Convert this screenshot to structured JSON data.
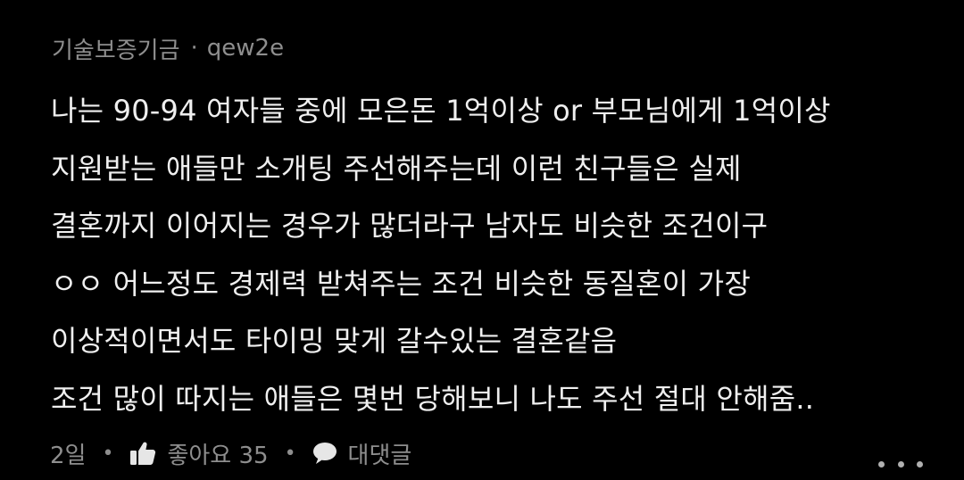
{
  "comment": {
    "author_group": "기술보증기금",
    "separator": "·",
    "username": "qew2e",
    "lines": [
      "나는 90-94 여자들 중에 모은돈 1억이상 or 부모님에게 1억이상",
      "지원받는 애들만 소개팅 주선해주는데 이런 친구들은 실제",
      "결혼까지 이어지는 경우가 많더라구 남자도 비슷한 조건이구",
      "ㅇㅇ 어느정도 경제력 받쳐주는 조건 비슷한 동질혼이 가장",
      "이상적이면서도 타이밍 맞게 갈수있는 결혼같음",
      "조건 많이 따지는 애들은 몇번 당해보니 나도 주선 절대 안해줌.."
    ],
    "footer": {
      "time": "2일",
      "dot": "•",
      "like_label": "좋아요 35",
      "reply_label": "대댓글"
    }
  },
  "colors": {
    "background": "#000000",
    "text": "#efefef",
    "muted": "#8e8e8e"
  },
  "icons": {
    "like": "thumbs-up-icon",
    "reply": "speech-bubble-icon",
    "more": "more-dots-icon"
  }
}
